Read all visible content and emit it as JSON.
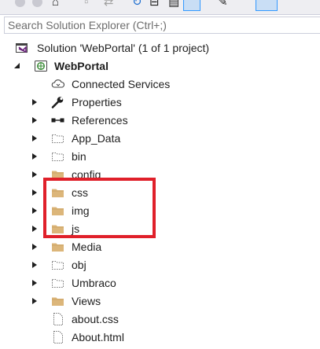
{
  "search": {
    "placeholder": "Search Solution Explorer (Ctrl+;)"
  },
  "toolbar": {
    "icons": [
      "back-icon",
      "forward-icon",
      "home-icon",
      "pending-changes-icon",
      "sync-icon",
      "refresh-icon",
      "collapse-all-icon",
      "show-all-files-icon",
      "properties-wrench-icon",
      "preview-icon"
    ]
  },
  "tree": {
    "solution": {
      "label": "Solution 'WebPortal' (1 of 1 project)",
      "icon": "solution-icon"
    },
    "project": {
      "label": "WebPortal",
      "icon": "web-project-globe-icon",
      "expanded": true
    },
    "items": [
      {
        "label": "Connected Services",
        "icon": "connected-services-icon",
        "expandable": false
      },
      {
        "label": "Properties",
        "icon": "wrench-icon",
        "expandable": true
      },
      {
        "label": "References",
        "icon": "references-icon",
        "expandable": true
      },
      {
        "label": "App_Data",
        "icon": "excluded-folder-icon",
        "expandable": true
      },
      {
        "label": "bin",
        "icon": "excluded-folder-icon",
        "expandable": true
      },
      {
        "label": "config",
        "icon": "folder-icon",
        "expandable": true
      },
      {
        "label": "css",
        "icon": "folder-icon",
        "expandable": true
      },
      {
        "label": "img",
        "icon": "folder-icon",
        "expandable": true
      },
      {
        "label": "js",
        "icon": "folder-icon",
        "expandable": true
      },
      {
        "label": "Media",
        "icon": "folder-icon",
        "expandable": true
      },
      {
        "label": "obj",
        "icon": "excluded-folder-icon",
        "expandable": true
      },
      {
        "label": "Umbraco",
        "icon": "excluded-folder-icon",
        "expandable": true
      },
      {
        "label": "Views",
        "icon": "folder-icon",
        "expandable": true
      },
      {
        "label": "about.css",
        "icon": "file-icon",
        "expandable": false
      },
      {
        "label": "About.html",
        "icon": "file-icon",
        "expandable": false
      }
    ]
  },
  "colors": {
    "folder": "#dcb67a",
    "highlight": "#e0202a",
    "arrow": "#1e1e1e"
  }
}
